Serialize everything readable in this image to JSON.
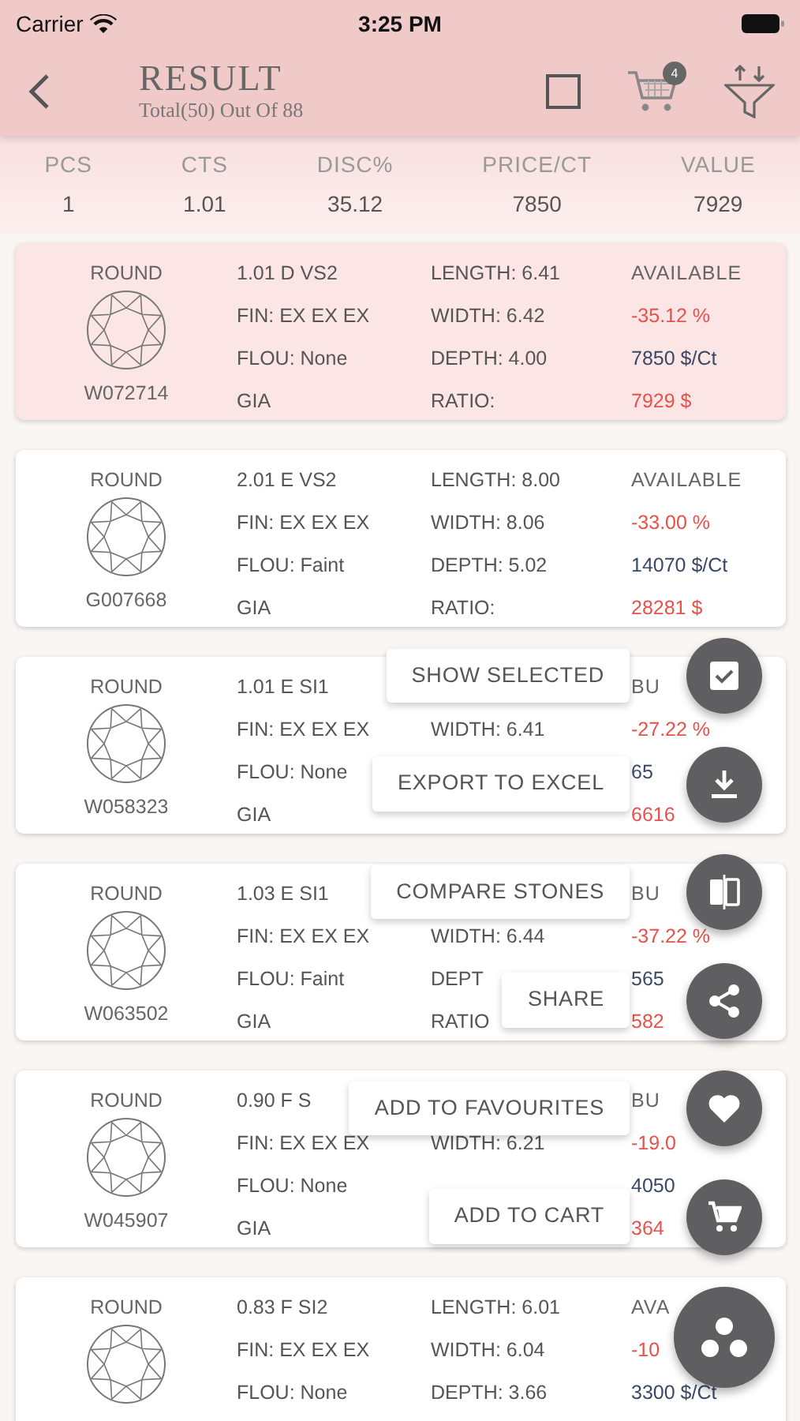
{
  "status_bar": {
    "carrier": "Carrier",
    "time": "3:25 PM"
  },
  "header": {
    "title": "RESULT",
    "subtitle": "Total(50) Out Of 88",
    "select_all_checked": false,
    "cart_count": "4"
  },
  "summary": [
    {
      "label": "PCS",
      "value": "1"
    },
    {
      "label": "CTS",
      "value": "1.01"
    },
    {
      "label": "DISC%",
      "value": "35.12"
    },
    {
      "label": "PRICE/CT",
      "value": "7850"
    },
    {
      "label": "VALUE",
      "value": "7929"
    }
  ],
  "stones": [
    {
      "selected": true,
      "shape": "ROUND",
      "stock_id": "W072714",
      "spec": "1.01 D VS2",
      "fin": "FIN: EX EX EX",
      "flou": "FLOU: None",
      "lab": "GIA",
      "length": "LENGTH: 6.41",
      "width": "WIDTH: 6.42",
      "depth": "DEPTH: 4.00",
      "ratio": "RATIO:",
      "status": "AVAILABLE",
      "disc": "-35.12 %",
      "price": "7850 $/Ct",
      "value": "7929 $"
    },
    {
      "selected": false,
      "shape": "ROUND",
      "stock_id": "G007668",
      "spec": "2.01 E VS2",
      "fin": "FIN: EX EX EX",
      "flou": "FLOU: Faint",
      "lab": "GIA",
      "length": "LENGTH: 8.00",
      "width": "WIDTH: 8.06",
      "depth": "DEPTH: 5.02",
      "ratio": "RATIO:",
      "status": "AVAILABLE",
      "disc": "-33.00 %",
      "price": "14070 $/Ct",
      "value": "28281 $"
    },
    {
      "selected": false,
      "shape": "ROUND",
      "stock_id": "W058323",
      "spec": "1.01 E SI1",
      "fin": "FIN: EX EX EX",
      "flou": "FLOU: None",
      "lab": "GIA",
      "width": "WIDTH: 6.41",
      "status": "BU",
      "disc": "-27.22 %",
      "price": "65",
      "value": "6616"
    },
    {
      "selected": false,
      "shape": "ROUND",
      "stock_id": "W063502",
      "spec": "1.03 E SI1",
      "fin": "FIN: EX EX EX",
      "flou": "FLOU: Faint",
      "lab": "GIA",
      "width": "WIDTH: 6.44",
      "depth": "DEPT",
      "ratio": "RATIO",
      "status": "BU",
      "disc": "-37.22 %",
      "price": "565",
      "value": "582"
    },
    {
      "selected": false,
      "shape": "ROUND",
      "stock_id": "W045907",
      "spec": "0.90 F S",
      "fin": "FIN: EX EX EX",
      "flou": "FLOU: None",
      "lab": "GIA",
      "width": "WIDTH: 6.21",
      "status": "BU",
      "disc": "-19.0",
      "price": "4050",
      "value": "364"
    },
    {
      "selected": false,
      "shape": "ROUND",
      "spec": "0.83 F SI2",
      "fin": "FIN: EX EX EX",
      "flou": "FLOU: None",
      "length": "LENGTH: 6.01",
      "width": "WIDTH: 6.04",
      "depth": "DEPTH: 3.66",
      "status": "AVA",
      "disc": "-10",
      "price": "3300 $/Ct"
    }
  ],
  "actions": [
    {
      "label": "SHOW SELECTED"
    },
    {
      "label": "EXPORT TO EXCEL"
    },
    {
      "label": "COMPARE STONES"
    },
    {
      "label": "SHARE"
    },
    {
      "label": "ADD TO FAVOURITES"
    },
    {
      "label": "ADD TO CART"
    }
  ]
}
